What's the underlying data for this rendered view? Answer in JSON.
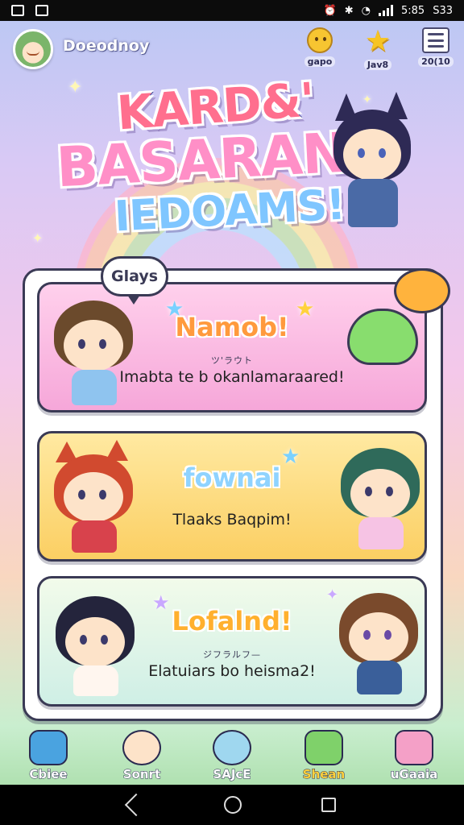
{
  "status_bar": {
    "time": "5:85",
    "battery": "S33"
  },
  "top_bar": {
    "username": "Doeodnoy",
    "buttons": [
      {
        "icon": "smiley-icon",
        "label": "gapo"
      },
      {
        "icon": "star-icon",
        "label": "Jav8"
      },
      {
        "icon": "list-icon",
        "label": "20(10"
      }
    ]
  },
  "title": {
    "line1": "KARD&'",
    "line2": "BASARAN",
    "line3": "IEDOAMS!"
  },
  "panel": {
    "tag": "Glays",
    "cards": [
      {
        "title": "Namob!",
        "subtitle": "ツ'ラウト",
        "desc": "Imabta te b okanlamaraared!",
        "color": "#ff9a3d"
      },
      {
        "title": "fownai",
        "subtitle": "",
        "desc": "Tlaaks Baqpim!",
        "color": "#8fd3ff"
      },
      {
        "title": "Lofalnd!",
        "subtitle": "ジフラルフ—",
        "desc": "Elatuiars bo heisma2!",
        "color": "#ffb02e"
      }
    ]
  },
  "bottom_nav": [
    {
      "icon": "castle-icon",
      "label": "Cbiee"
    },
    {
      "icon": "bear-icon",
      "label": "Sonrt"
    },
    {
      "icon": "orb-icon",
      "label": "SAJcE"
    },
    {
      "icon": "bucket-icon",
      "label": "Shean"
    },
    {
      "icon": "tower-icon",
      "label": "uGaaia"
    }
  ]
}
